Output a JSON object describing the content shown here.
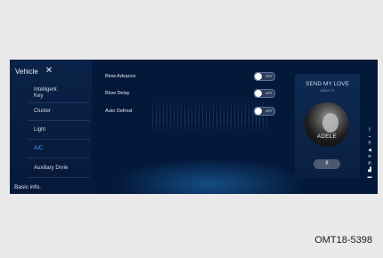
{
  "nav": {
    "title": "Vehicle",
    "close_icon": "close-icon",
    "items": [
      {
        "label": "Intelligent Key",
        "active": false
      },
      {
        "label": "Cluster",
        "active": false
      },
      {
        "label": "Light",
        "active": false
      },
      {
        "label": "A/C",
        "active": true
      },
      {
        "label": "Auxiliary Drvie",
        "active": false
      }
    ],
    "bottom": "Basic info."
  },
  "settings": [
    {
      "label": "Blow Advance",
      "state": "OFF"
    },
    {
      "label": "Blow Delay",
      "state": "OFF"
    },
    {
      "label": "Auto Defrost",
      "state": "OFF"
    }
  ],
  "player": {
    "title": "SEND MY LOVE",
    "artist": "ADELE 21",
    "album_text": "ADELE",
    "pause_icon": "pause-icon",
    "pause_glyph": "II"
  },
  "status_icons": [
    "bluetooth-icon",
    "usb-icon",
    "volume-icon",
    "wifi-icon",
    "phone-icon",
    "signal-icon",
    "battery-icon"
  ],
  "figure_code": "OMT18-5398",
  "colors": {
    "background": "#04183a",
    "accent": "#4ea8ff",
    "page": "#e9e9e9"
  }
}
